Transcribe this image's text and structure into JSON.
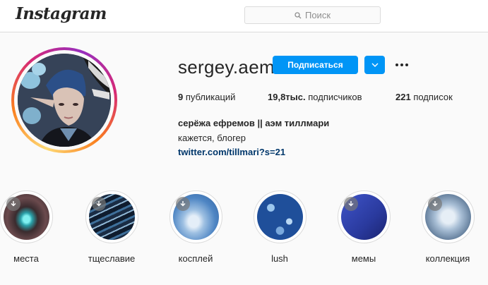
{
  "header": {
    "logo": "Instagram",
    "search_placeholder": "Поиск"
  },
  "profile": {
    "username": "sergey.aem",
    "follow_label": "Подписаться",
    "posts_count": "9",
    "posts_label": "публикаций",
    "followers_count": "19,8тыс.",
    "followers_label": "подписчиков",
    "following_count": "221",
    "following_label": "подписок",
    "full_name": "серёжа ефремов || аэм тиллмари",
    "bio": "кажется, блогер",
    "link": "twitter.com/tillmari?s=21"
  },
  "highlights": [
    {
      "label": "места"
    },
    {
      "label": "тщеславие"
    },
    {
      "label": "косплей"
    },
    {
      "label": "lush"
    },
    {
      "label": "мемы"
    },
    {
      "label": "коллекция"
    }
  ],
  "colors": {
    "accent": "#0095f6",
    "link": "#00376b",
    "text": "#262626",
    "muted": "#8e8e8e",
    "border": "#dbdbdb",
    "background": "#fafafa"
  }
}
